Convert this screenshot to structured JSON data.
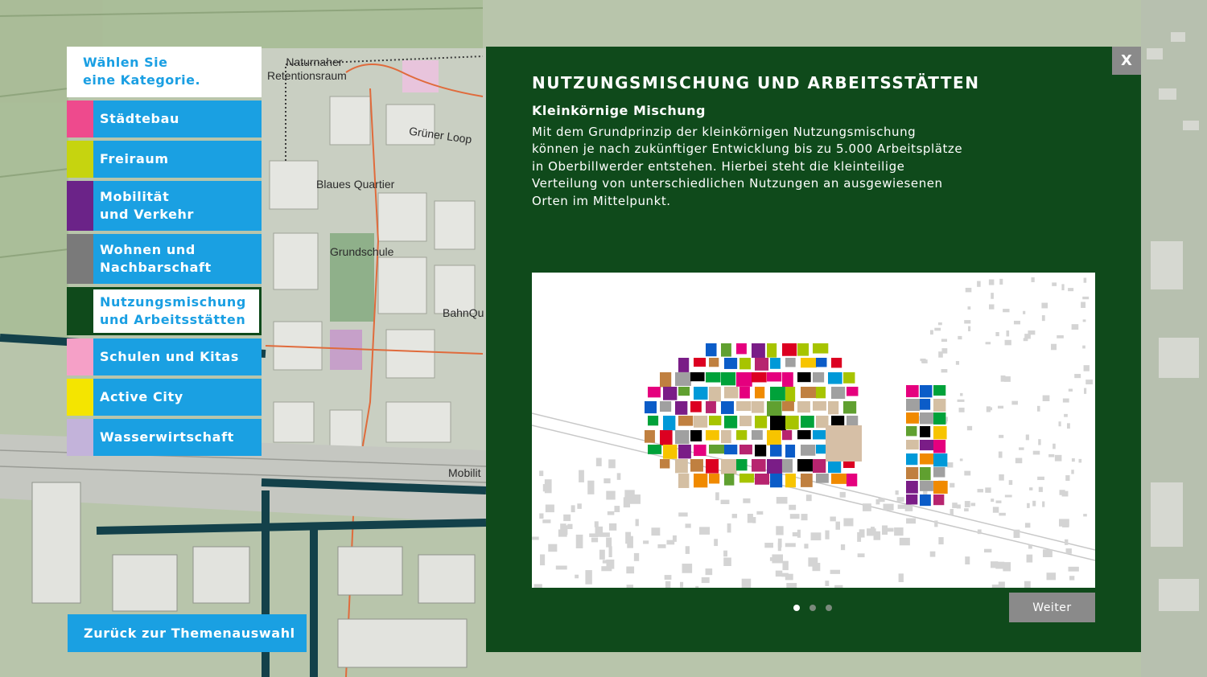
{
  "map": {
    "labels": [
      "Naturnaher",
      "Retentionsraum",
      "Grüner Loop",
      "Blaues Quartier",
      "Grundschule",
      "BahnQu",
      "Mobilit"
    ]
  },
  "sidebar": {
    "header": [
      "Wählen Sie",
      "eine Kategorie."
    ],
    "items": [
      {
        "label": [
          "Städtebau"
        ],
        "color": "#ee4a8d"
      },
      {
        "label": [
          "Freiraum"
        ],
        "color": "#c6d40f"
      },
      {
        "label": [
          "Mobilität",
          "und Verkehr"
        ],
        "color": "#6b2388"
      },
      {
        "label": [
          "Wohnen und",
          "Nachbarschaft"
        ],
        "color": "#7a7a7a"
      },
      {
        "label": [
          "Nutzungsmischung",
          "und Arbeitsstätten"
        ],
        "color": "#0f4a1b",
        "active": true
      },
      {
        "label": [
          "Schulen und Kitas"
        ],
        "color": "#f5a0c7"
      },
      {
        "label": [
          "Active City"
        ],
        "color": "#f4e500"
      },
      {
        "label": [
          "Wasserwirtschaft"
        ],
        "color": "#c3b3da"
      }
    ],
    "accent": "#1aa0e2"
  },
  "back_button": "Zurück zur Themenauswahl",
  "modal": {
    "close_label": "X",
    "title": "NUTZUNGSMISCHUNG UND ARBEITSSTÄTTEN",
    "subtitle": "Kleinkörnige Mischung",
    "body": [
      "Mit dem Grundprinzip der kleinkörnigen Nutzungsmischung",
      "können je nach zukünftiger Entwicklung bis zu 5.000 Arbeitsplätze",
      "in Oberbillwerder entstehen. Hierbei steht die kleinteilige",
      "Verteilung von unterschiedlichen Nutzungen an ausgewiesenen",
      "Orten im Mittelpunkt."
    ],
    "pagination": {
      "total": 3,
      "current": 1
    },
    "next_label": "Weiter",
    "background": "#0f4a1b"
  }
}
